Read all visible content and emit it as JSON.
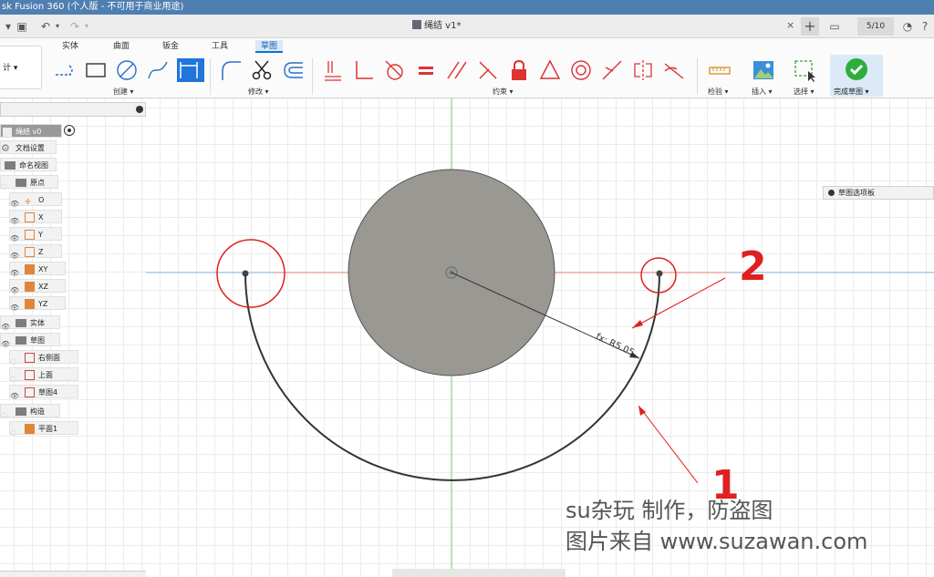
{
  "window": {
    "title": "sk Fusion 360 (个人版 - 不可用于商业用途)"
  },
  "document": {
    "tab_title": "绳结 v1*",
    "close": "×",
    "new_tab": "+",
    "job_status": "5/10"
  },
  "toolbar": {
    "tabs": [
      "实体",
      "曲面",
      "钣金",
      "工具",
      "草图"
    ],
    "active_tab": "草图",
    "workspace_switch": "计",
    "groups": {
      "create": "创建",
      "modify": "修改",
      "constraints": "约束",
      "inspect": "检验",
      "insert": "插入",
      "select": "选择",
      "finish": "完成草图"
    }
  },
  "browser": {
    "root": "绳结 v0",
    "items": [
      "文档设置",
      "命名视图",
      "原点",
      "O",
      "X",
      "Y",
      "Z",
      "XY",
      "XZ",
      "YZ",
      "实体",
      "草图",
      "右侧面",
      "上面",
      "草图4",
      "构造",
      "平面1"
    ]
  },
  "sketch_palette": "草图选项板",
  "sketch": {
    "dimension_label": "fx: R5.05"
  },
  "annotations": {
    "label_1": "1",
    "label_2": "2"
  },
  "watermark": {
    "line1": "su杂玩 制作，防盗图",
    "line2": "图片来自 www.suzawan.com"
  },
  "colors": {
    "accent": "#0a73d9",
    "annotation": "#e02020",
    "disk": "#999893",
    "x_axis": "#f08080",
    "y_axis": "#7ccf7c"
  }
}
